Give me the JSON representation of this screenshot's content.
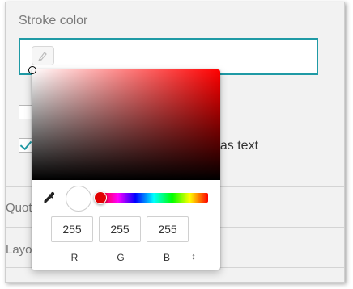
{
  "field": {
    "label": "Stroke color"
  },
  "background": {
    "option_text_1": "",
    "option_text_2": "t as text",
    "section_1": "Quot",
    "section_2": "Layo"
  },
  "picker": {
    "rgb": {
      "r": "255",
      "g": "255",
      "b": "255"
    },
    "labels": {
      "r": "R",
      "g": "G",
      "b": "B"
    },
    "mode_toggle": "↕",
    "selected_color": "#ffffff",
    "hue_color": "#ff0000",
    "accent": "#1f9aa5"
  }
}
